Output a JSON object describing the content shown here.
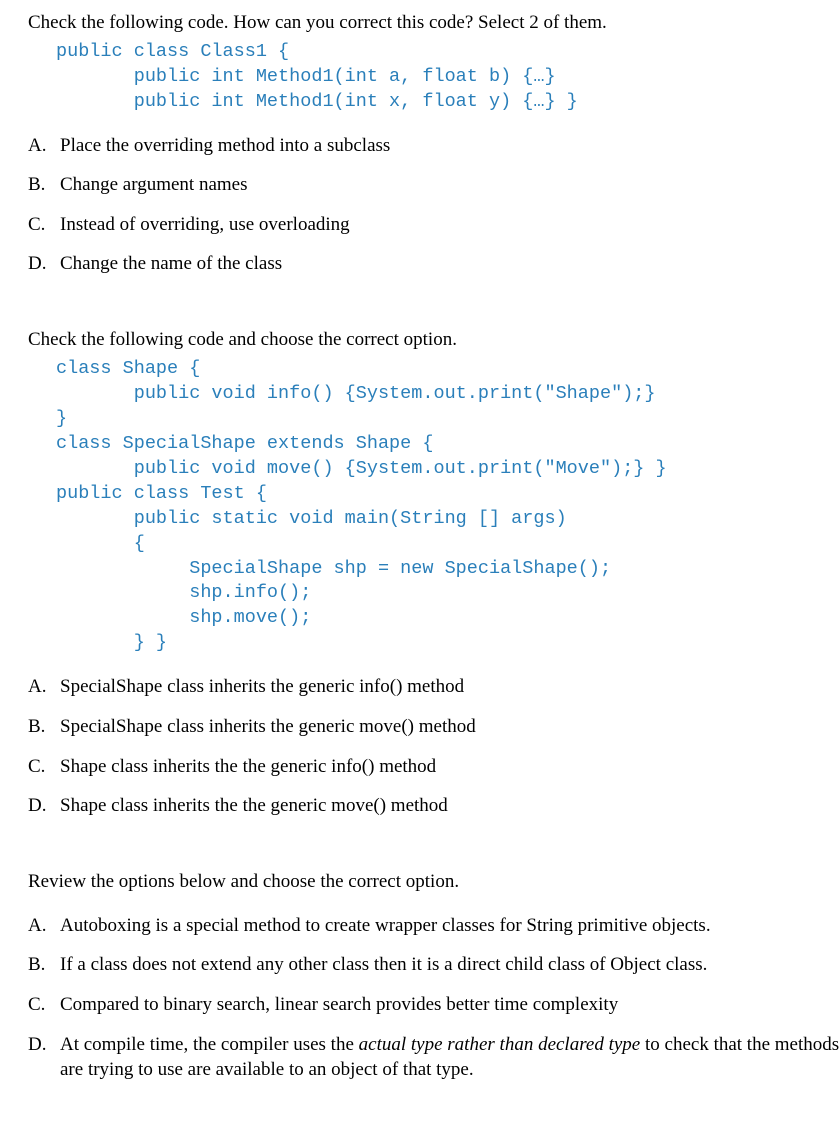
{
  "q1": {
    "prompt": "Check the following code. How can you correct this code? Select 2 of them.",
    "code": "public class Class1 {\n       public int Method1(int a, float b) {…}\n       public int Method1(int x, float y) {…} }",
    "options": {
      "a": {
        "letter": "A.",
        "text": "Place the overriding method into a subclass"
      },
      "b": {
        "letter": "B.",
        "text": "Change argument names"
      },
      "c": {
        "letter": "C.",
        "text": "Instead of overriding, use overloading"
      },
      "d": {
        "letter": "D.",
        "text": "Change the name of the class"
      }
    }
  },
  "q2": {
    "prompt": "Check the following code and choose the correct option.",
    "code": "class Shape {\n       public void info() {System.out.print(\"Shape\");}  \n}\nclass SpecialShape extends Shape {\n       public void move() {System.out.print(\"Move\");} }\npublic class Test {\n       public static void main(String [] args)\n       {\n            SpecialShape shp = new SpecialShape();\n            shp.info();\n            shp.move();\n       } }",
    "options": {
      "a": {
        "letter": "A.",
        "text": "SpecialShape class inherits the generic info() method"
      },
      "b": {
        "letter": "B.",
        "text": "SpecialShape class inherits the generic move() method"
      },
      "c": {
        "letter": "C.",
        "text": "Shape class inherits the the generic info() method"
      },
      "d": {
        "letter": "D.",
        "text": "Shape class inherits the the generic move() method"
      }
    }
  },
  "q3": {
    "prompt": "Review the options below and choose the correct option.",
    "options": {
      "a": {
        "letter": "A.",
        "text": "Autoboxing is a special method to create wrapper classes for String primitive objects."
      },
      "b": {
        "letter": "B.",
        "text": "If a class does not extend any other class then it is a direct child class of Object class."
      },
      "c": {
        "letter": "C.",
        "text": "Compared to binary search, linear search provides better time complexity"
      },
      "d": {
        "letter": "D.",
        "pre": "At compile time, the compiler uses the ",
        "italic": "actual type rather than declared type",
        "post": " to check that the methods we are trying to use are available to an object of that type."
      }
    }
  }
}
